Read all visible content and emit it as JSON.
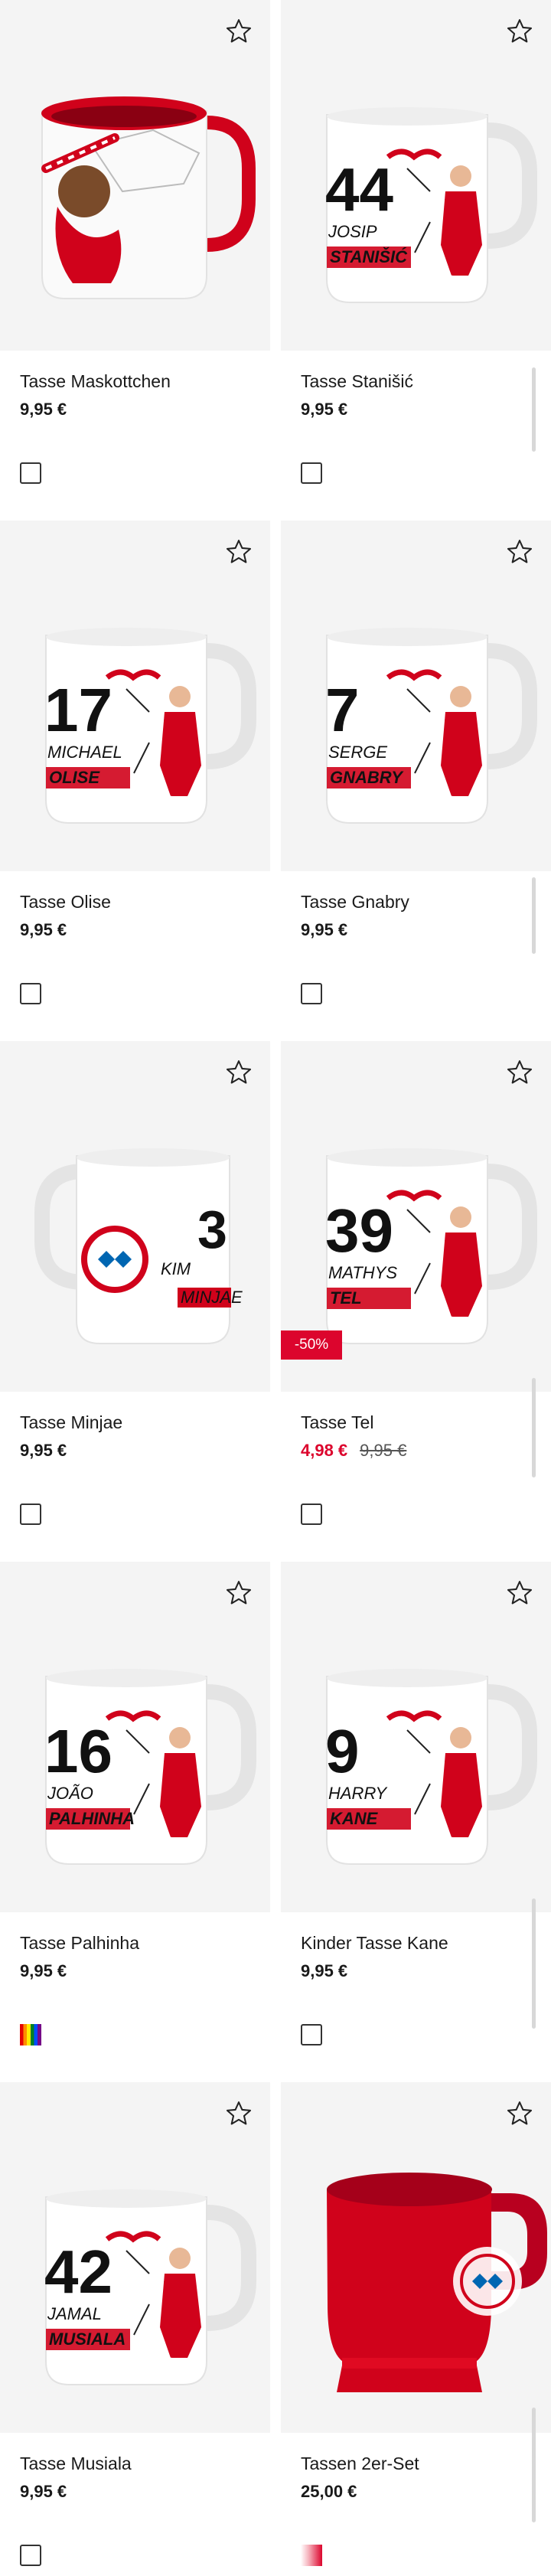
{
  "products": [
    {
      "name": "Tasse Maskottchen",
      "price": "9,95 €",
      "old_price": "",
      "badge": "",
      "variant": "checkbox",
      "art": "mascot",
      "number": "",
      "first": "",
      "last": ""
    },
    {
      "name": "Tasse Stanišić",
      "price": "9,95 €",
      "old_price": "",
      "badge": "",
      "variant": "checkbox",
      "art": "player",
      "number": "44",
      "first": "JOSIP",
      "last": "STANIŠIĆ"
    },
    {
      "name": "Tasse Olise",
      "price": "9,95 €",
      "old_price": "",
      "badge": "",
      "variant": "checkbox",
      "art": "player",
      "number": "17",
      "first": "MICHAEL",
      "last": "OLISE"
    },
    {
      "name": "Tasse Gnabry",
      "price": "9,95 €",
      "old_price": "",
      "badge": "",
      "variant": "checkbox",
      "art": "player",
      "number": "7",
      "first": "SERGE",
      "last": "GNABRY"
    },
    {
      "name": "Tasse Minjae",
      "price": "9,95 €",
      "old_price": "",
      "badge": "",
      "variant": "checkbox",
      "art": "crest-left",
      "number": "3",
      "first": "KIM",
      "last": "MINJAE"
    },
    {
      "name": "Tasse Tel",
      "price": "4,98 €",
      "old_price": "9,95 €",
      "badge": "-50%",
      "variant": "checkbox",
      "art": "player",
      "number": "39",
      "first": "MATHYS",
      "last": "TEL"
    },
    {
      "name": "Tasse Palhinha",
      "price": "9,95 €",
      "old_price": "",
      "badge": "",
      "variant": "rainbow",
      "art": "player",
      "number": "16",
      "first": "JOÃO",
      "last": "PALHINHA"
    },
    {
      "name": "Kinder Tasse Kane",
      "price": "9,95 €",
      "old_price": "",
      "badge": "",
      "variant": "checkbox",
      "art": "player",
      "number": "9",
      "first": "HARRY",
      "last": "KANE"
    },
    {
      "name": "Tasse Musiala",
      "price": "9,95 €",
      "old_price": "",
      "badge": "",
      "variant": "checkbox",
      "art": "player",
      "number": "42",
      "first": "JAMAL",
      "last": "MUSIALA"
    },
    {
      "name": "Tassen 2er-Set",
      "price": "25,00 €",
      "old_price": "",
      "badge": "",
      "variant": "red",
      "art": "red-mug",
      "number": "",
      "first": "",
      "last": ""
    }
  ],
  "icons": {
    "favorite": "star-outline-icon"
  },
  "colors": {
    "accent": "#dc052d",
    "text": "#1a1a1a",
    "image_bg": "#f4f4f4"
  }
}
